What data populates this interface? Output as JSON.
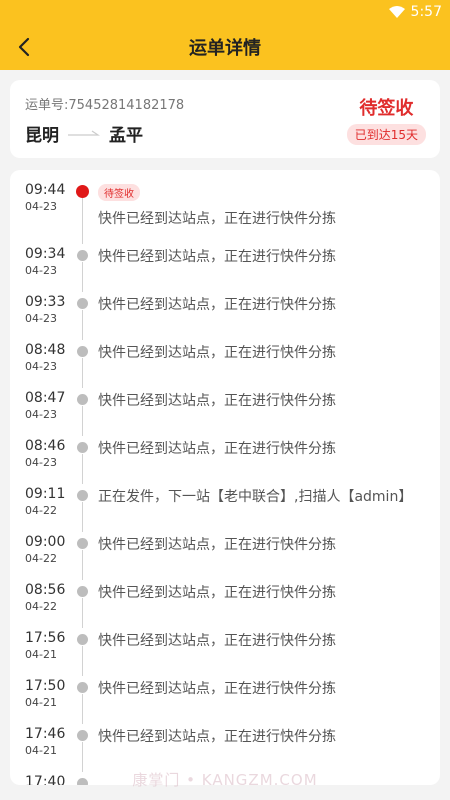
{
  "status_bar": {
    "time": "5:57"
  },
  "header": {
    "title": "运单详情"
  },
  "summary": {
    "waybill_label": "运单号:",
    "waybill_number": "75452814182178",
    "origin": "昆明",
    "destination": "孟平",
    "status": "待签收",
    "days": "已到达15天"
  },
  "timeline": [
    {
      "time": "09:44",
      "date": "04-23",
      "badge": "待签收",
      "desc": "快件已经到达站点，正在进行快件分拣"
    },
    {
      "time": "09:34",
      "date": "04-23",
      "desc": "快件已经到达站点，正在进行快件分拣"
    },
    {
      "time": "09:33",
      "date": "04-23",
      "desc": "快件已经到达站点，正在进行快件分拣"
    },
    {
      "time": "08:48",
      "date": "04-23",
      "desc": "快件已经到达站点，正在进行快件分拣"
    },
    {
      "time": "08:47",
      "date": "04-23",
      "desc": "快件已经到达站点，正在进行快件分拣"
    },
    {
      "time": "08:46",
      "date": "04-23",
      "desc": "快件已经到达站点，正在进行快件分拣"
    },
    {
      "time": "09:11",
      "date": "04-22",
      "desc": "正在发件，下一站【老中联合】,扫描人【admin】"
    },
    {
      "time": "09:00",
      "date": "04-22",
      "desc": "快件已经到达站点，正在进行快件分拣"
    },
    {
      "time": "08:56",
      "date": "04-22",
      "desc": "快件已经到达站点，正在进行快件分拣"
    },
    {
      "time": "17:56",
      "date": "04-21",
      "desc": "快件已经到达站点，正在进行快件分拣"
    },
    {
      "time": "17:50",
      "date": "04-21",
      "desc": "快件已经到达站点，正在进行快件分拣"
    },
    {
      "time": "17:46",
      "date": "04-21",
      "desc": "快件已经到达站点，正在进行快件分拣"
    },
    {
      "time": "17:40",
      "date": "",
      "desc": ""
    }
  ],
  "watermark": "康掌门 • KANGZM.COM",
  "colors": {
    "header": "#fbc21f",
    "accent_red": "#e02c2c",
    "dot_gray": "#bdbdbd"
  }
}
